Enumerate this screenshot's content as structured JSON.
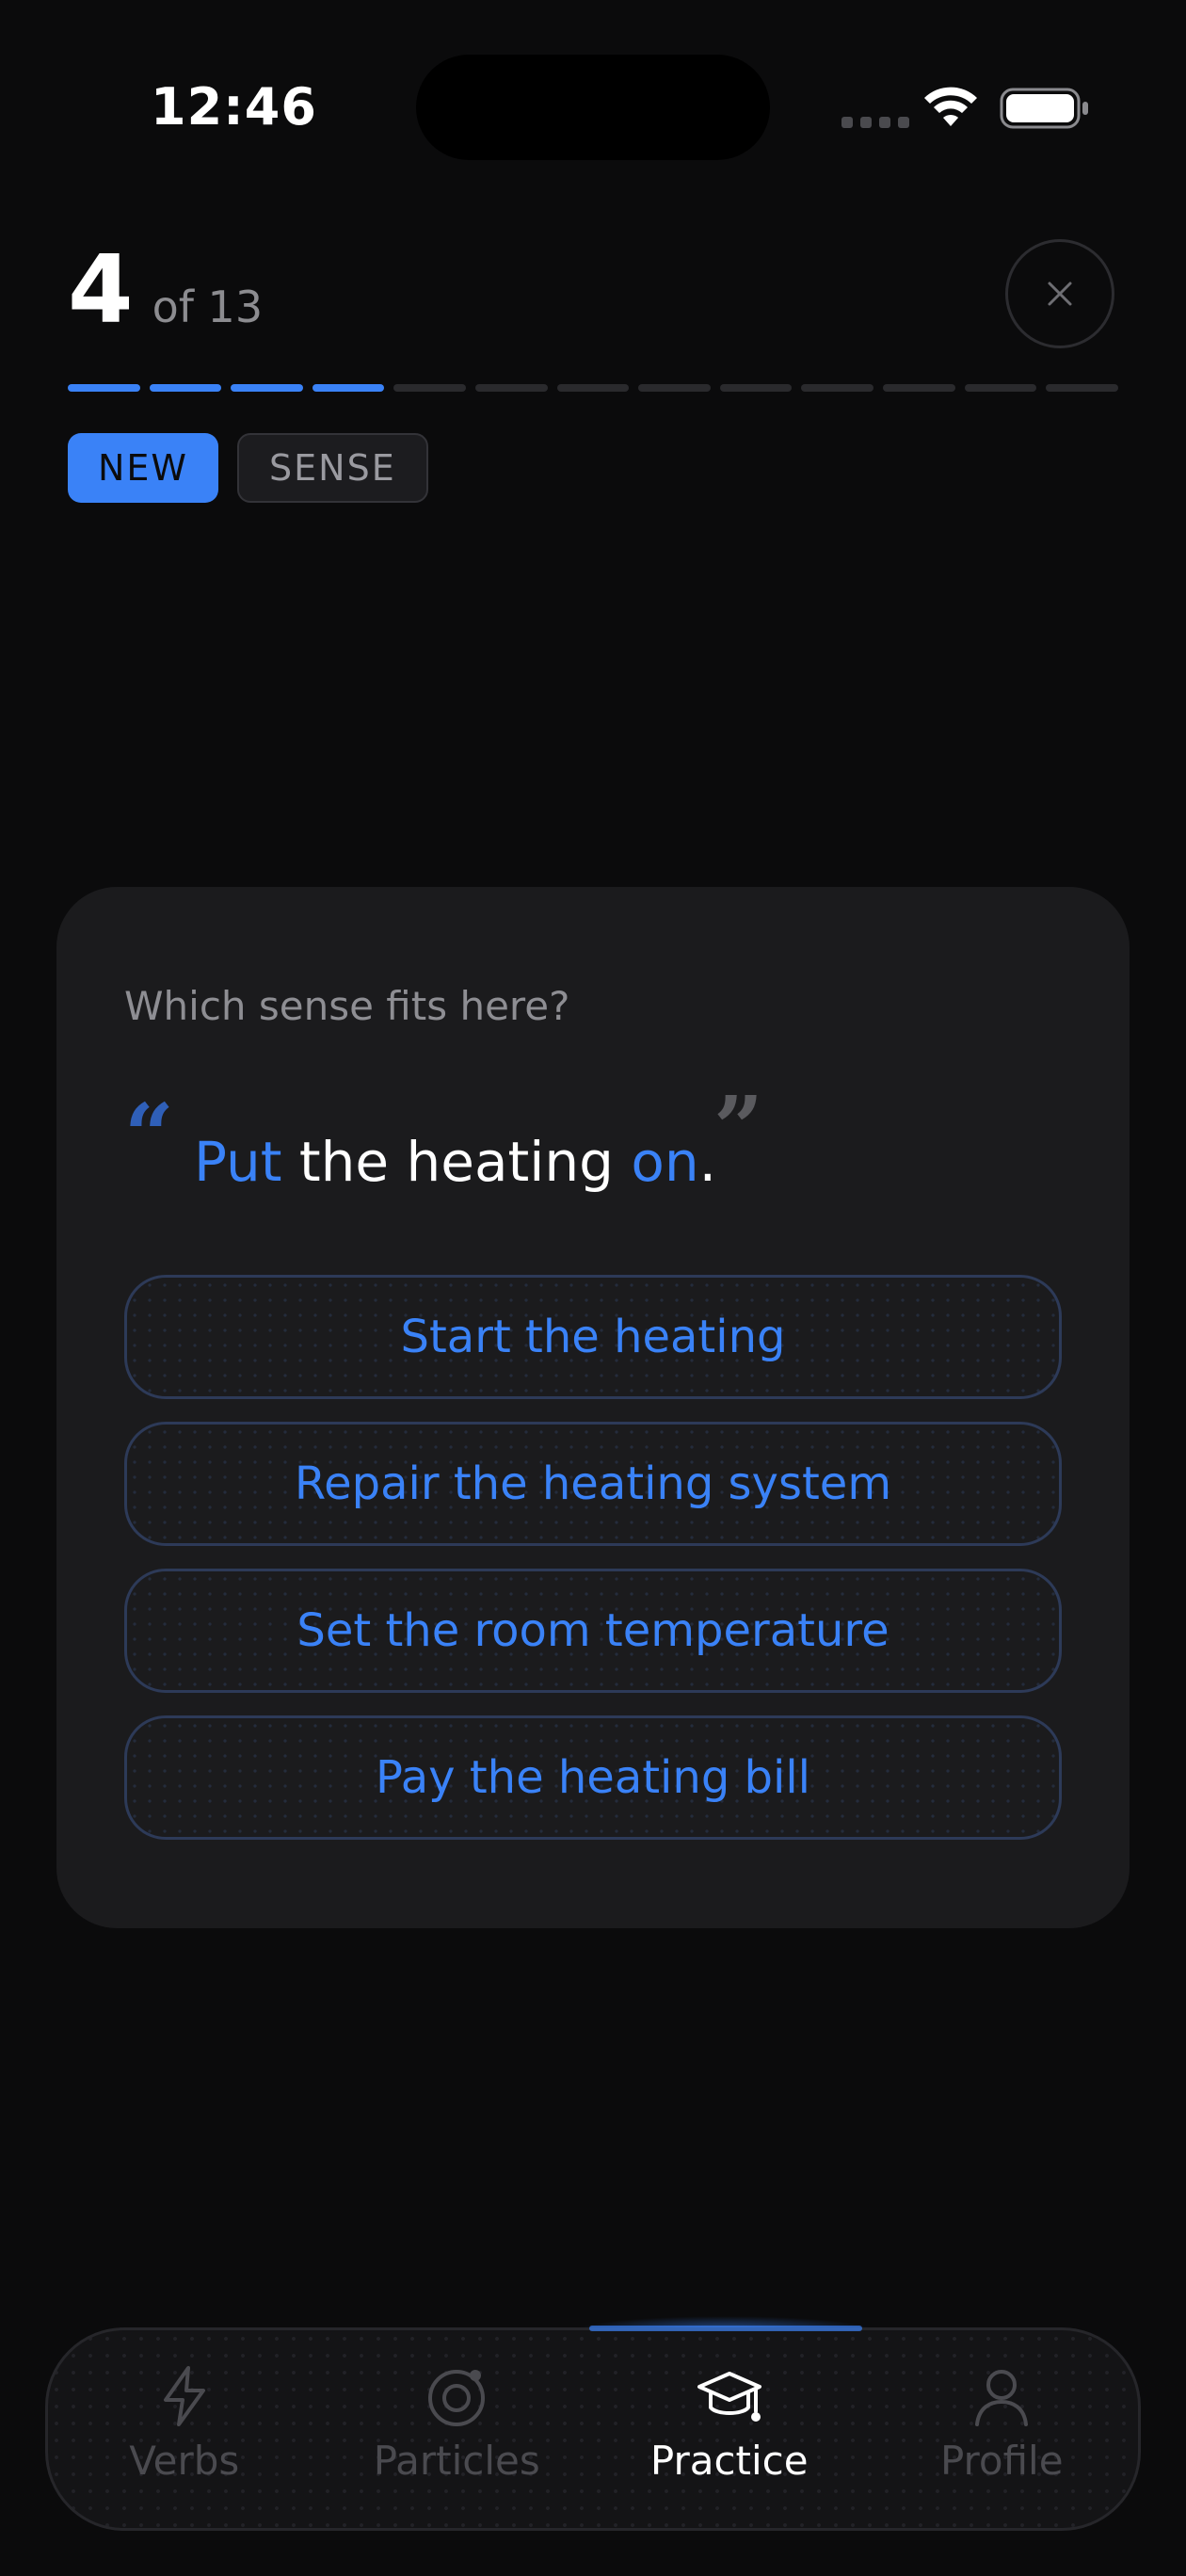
{
  "status_bar": {
    "time": "12:46"
  },
  "header": {
    "current": "4",
    "total_label": "of 13",
    "progress": {
      "completed": 4,
      "total": 13
    }
  },
  "tags": {
    "new": "NEW",
    "sense": "SENSE"
  },
  "question": {
    "prompt": "Which sense fits here?",
    "sentence": {
      "part1": "Put",
      "part2": " the heating ",
      "part3": "on",
      "part4": "."
    },
    "options": [
      {
        "label": "Start the heating"
      },
      {
        "label": "Repair the heating system"
      },
      {
        "label": "Set the room temperature"
      },
      {
        "label": "Pay the heating bill"
      }
    ]
  },
  "tab_bar": {
    "items": [
      {
        "label": "Verbs",
        "icon": "lightning-icon"
      },
      {
        "label": "Particles",
        "icon": "target-icon"
      },
      {
        "label": "Practice",
        "icon": "graduation-cap-icon",
        "active": true
      },
      {
        "label": "Profile",
        "icon": "person-icon"
      }
    ]
  },
  "colors": {
    "accent": "#3a82f7",
    "background": "#0b0b0c",
    "card": "#1b1b1d"
  }
}
